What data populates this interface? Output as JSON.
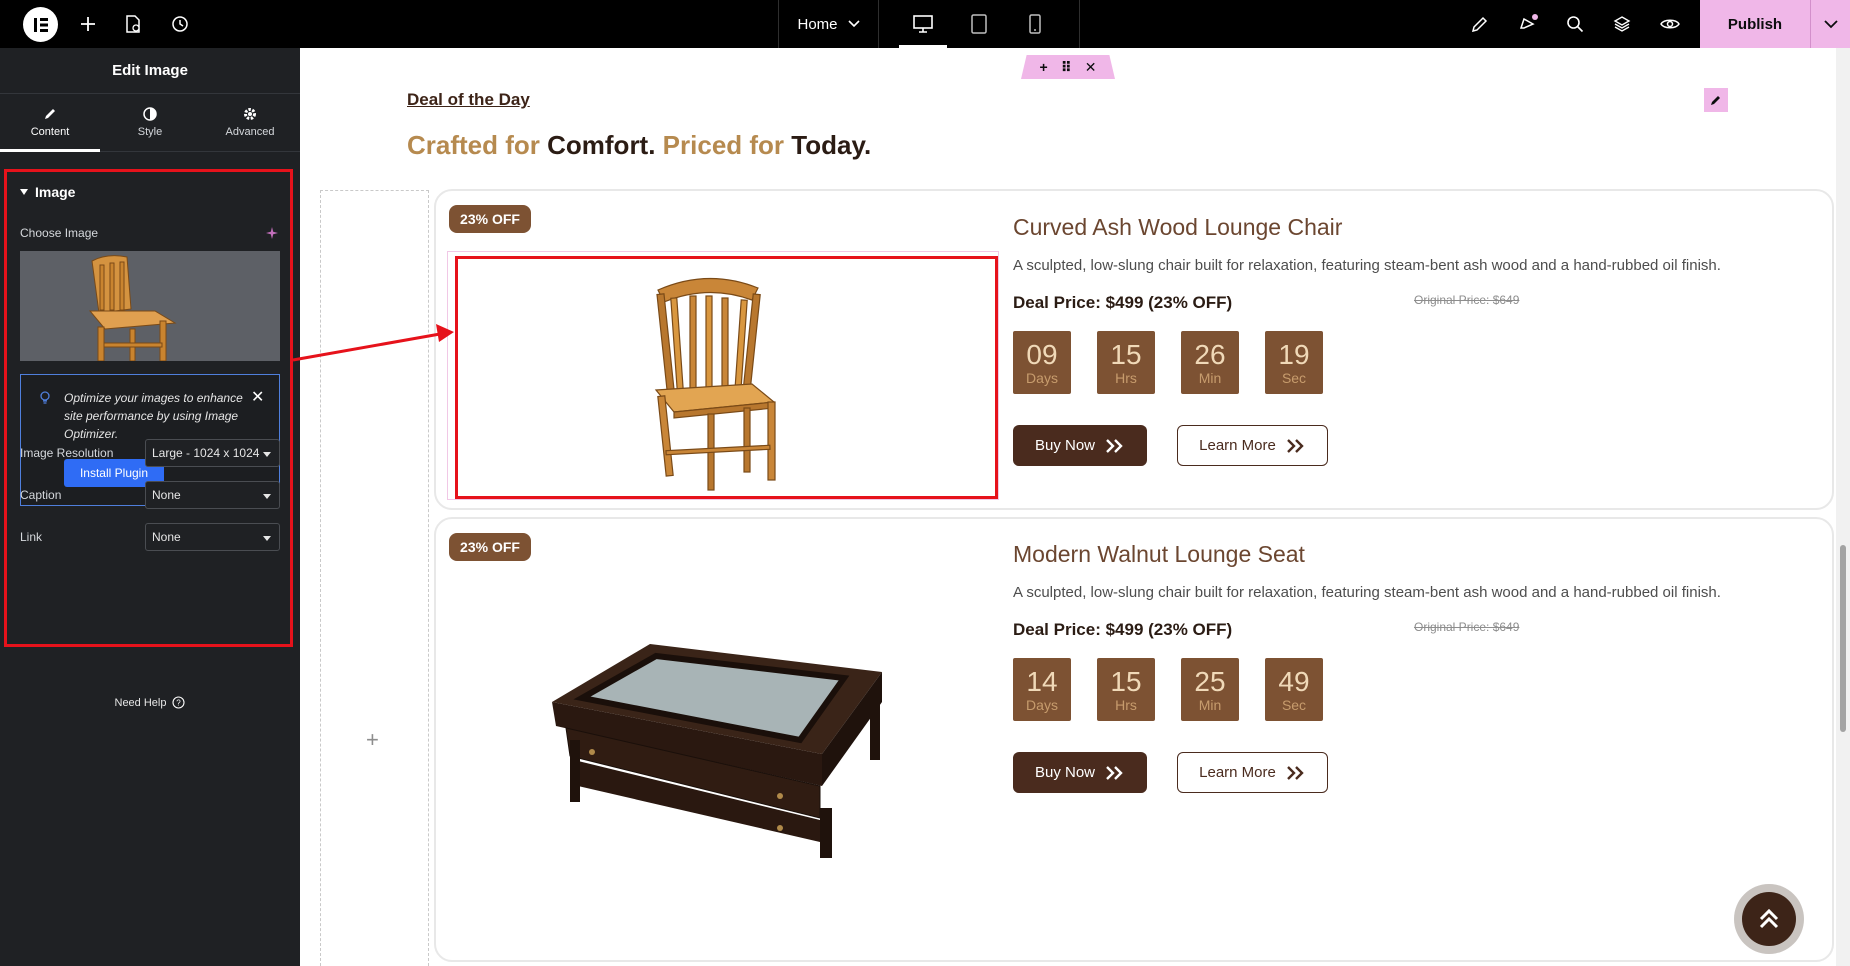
{
  "topbar": {
    "page_name": "Home",
    "publish_label": "Publish"
  },
  "panel": {
    "title": "Edit Image",
    "tabs": [
      {
        "label": "Content",
        "icon": "pencil-icon",
        "active": true
      },
      {
        "label": "Style",
        "icon": "contrast-icon",
        "active": false
      },
      {
        "label": "Advanced",
        "icon": "gear-icon",
        "active": false
      }
    ],
    "section_title": "Image",
    "choose_image_label": "Choose Image",
    "notice_text": "Optimize your images to enhance site performance by using Image Optimizer.",
    "install_label": "Install Plugin",
    "resolution_label": "Image Resolution",
    "resolution_value": "Large - 1024 x 1024",
    "caption_label": "Caption",
    "caption_value": "None",
    "link_label": "Link",
    "link_value": "None",
    "need_help": "Need Help"
  },
  "page": {
    "deal_link": "Deal of the Day",
    "headline": {
      "part1": "Crafted for ",
      "part2": "Comfort.",
      "part3": " Priced for ",
      "part4": "Today."
    }
  },
  "products": [
    {
      "badge": "23% OFF",
      "title": "Curved Ash Wood Lounge Chair",
      "description": "A sculpted, low-slung chair built for relaxation, featuring steam-bent ash wood and a hand-rubbed oil finish.",
      "deal_price": "Deal Price: $499 (23% OFF)",
      "original_price": "Original Price: $649",
      "countdown": [
        {
          "value": "09",
          "unit": "Days"
        },
        {
          "value": "15",
          "unit": "Hrs"
        },
        {
          "value": "26",
          "unit": "Min"
        },
        {
          "value": "19",
          "unit": "Sec"
        }
      ],
      "buy_label": "Buy Now",
      "learn_label": "Learn More"
    },
    {
      "badge": "23% OFF",
      "title": "Modern Walnut Lounge Seat",
      "description": "A sculpted, low-slung chair built for relaxation, featuring steam-bent ash wood and a hand-rubbed oil finish.",
      "deal_price": "Deal Price: $499 (23% OFF)",
      "original_price": "Original Price: $649",
      "countdown": [
        {
          "value": "14",
          "unit": "Days"
        },
        {
          "value": "15",
          "unit": "Hrs"
        },
        {
          "value": "25",
          "unit": "Min"
        },
        {
          "value": "49",
          "unit": "Sec"
        }
      ],
      "buy_label": "Buy Now",
      "learn_label": "Learn More"
    }
  ],
  "colors": {
    "accent_pink": "#f0b7e8",
    "highlight_red": "#e6121b",
    "brand_brown": "#7d5233",
    "dark_brown": "#4a2b1e",
    "gold": "#b68a4f"
  }
}
